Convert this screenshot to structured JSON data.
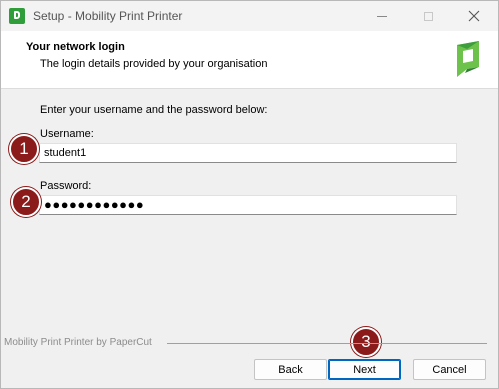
{
  "window": {
    "title": "Setup - Mobility Print Printer"
  },
  "header": {
    "title": "Your network login",
    "subtitle": "The login details provided by your organisation"
  },
  "form": {
    "instruction": "Enter your username and the password below:",
    "username_label": "Username:",
    "username_value": "student1",
    "password_label": "Password:",
    "password_value": "●●●●●●●●●●●●"
  },
  "footer": {
    "text": "Mobility Print Printer by PaperCut"
  },
  "buttons": {
    "back": "Back",
    "next": "Next",
    "cancel": "Cancel"
  },
  "callouts": {
    "one": "1",
    "two": "2",
    "three": "3"
  },
  "colors": {
    "callout": "#8b1a1a",
    "brand_green": "#2f9e3a",
    "focus_blue": "#0067c0"
  }
}
